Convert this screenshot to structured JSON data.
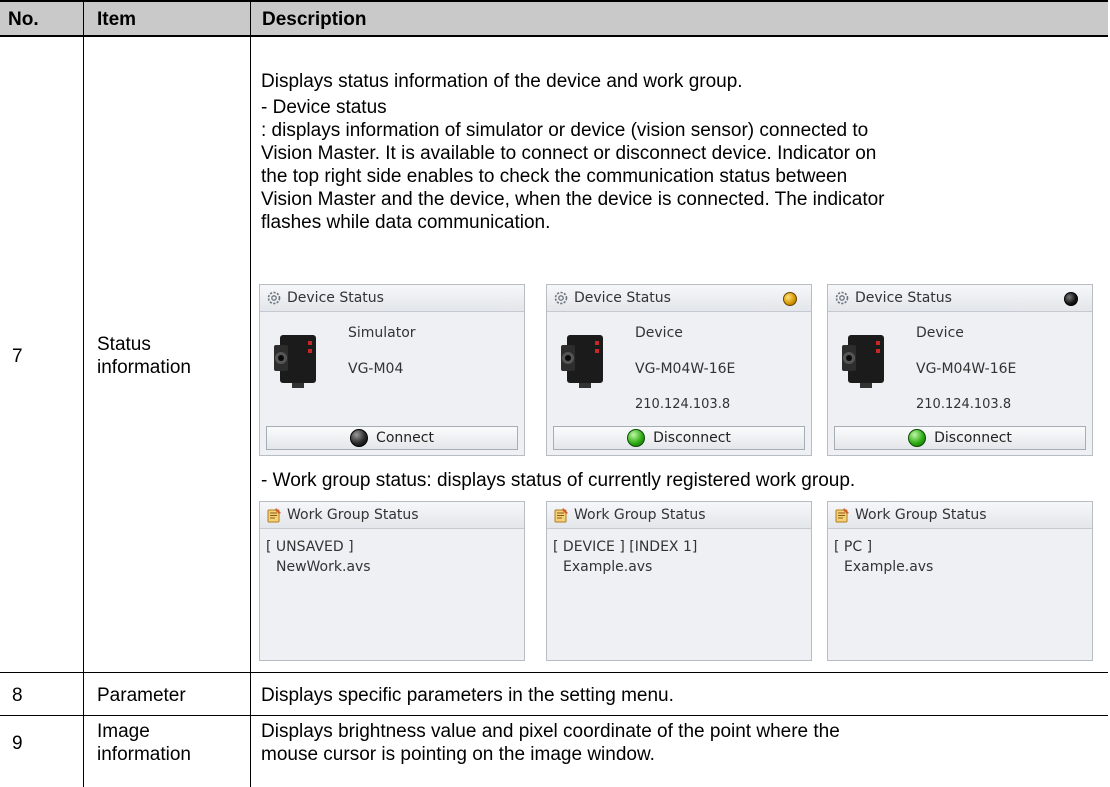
{
  "table": {
    "headers": {
      "no": "No.",
      "item": "Item",
      "description": "Description"
    },
    "rows": [
      {
        "no": "7",
        "item_line1": "Status",
        "item_line2": "information",
        "intro": "Displays status information of the device and work group.",
        "device_status_heading": "- Device status",
        "device_status_desc": [
          ": displays information of simulator or device (vision sensor) connected to",
          "Vision Master. It is available to connect or disconnect device. Indicator on",
          "the top right side enables to check the communication status between",
          "Vision Master and the device, when the device is connected. The indicator",
          "flashes while data communication."
        ],
        "device_panels": [
          {
            "title": "Device Status",
            "indicator": "none",
            "type": "Simulator",
            "model": "VG-M04",
            "ip": "",
            "button": "Connect",
            "button_led": "black"
          },
          {
            "title": "Device Status",
            "indicator": "orange",
            "type": "Device",
            "model": "VG-M04W-16E",
            "ip": "210.124.103.8",
            "button": "Disconnect",
            "button_led": "green"
          },
          {
            "title": "Device Status",
            "indicator": "black",
            "type": "Device",
            "model": "VG-M04W-16E",
            "ip": "210.124.103.8",
            "button": "Disconnect",
            "button_led": "green"
          }
        ],
        "work_group_desc": "- Work group status: displays status of currently registered work group.",
        "work_group_panels": [
          {
            "title": "Work Group Status",
            "tag": "[ UNSAVED ]",
            "file": "NewWork.avs"
          },
          {
            "title": "Work Group Status",
            "tag": "[ DEVICE ] [INDEX 1]",
            "file": "Example.avs"
          },
          {
            "title": "Work Group Status",
            "tag": "[ PC ]",
            "file": "Example.avs"
          }
        ]
      },
      {
        "no": "8",
        "item_line1": "Parameter",
        "description": "Displays specific parameters in the setting menu."
      },
      {
        "no": "9",
        "item_line1": "Image",
        "item_line2": "information",
        "description_line1": "Displays brightness value and pixel coordinate of the point where the",
        "description_line2": "mouse cursor is pointing on the image window."
      }
    ]
  },
  "icons": {
    "device_panel_header": "gear-icon",
    "work_group_panel_header": "notepad-icon",
    "device_image": "camera-sensor-icon"
  },
  "colors": {
    "header_bg": "#c9c9c9",
    "panel_bg": "#eef0f3",
    "indicator_orange": "#d49500",
    "led_green": "#2fae14"
  }
}
